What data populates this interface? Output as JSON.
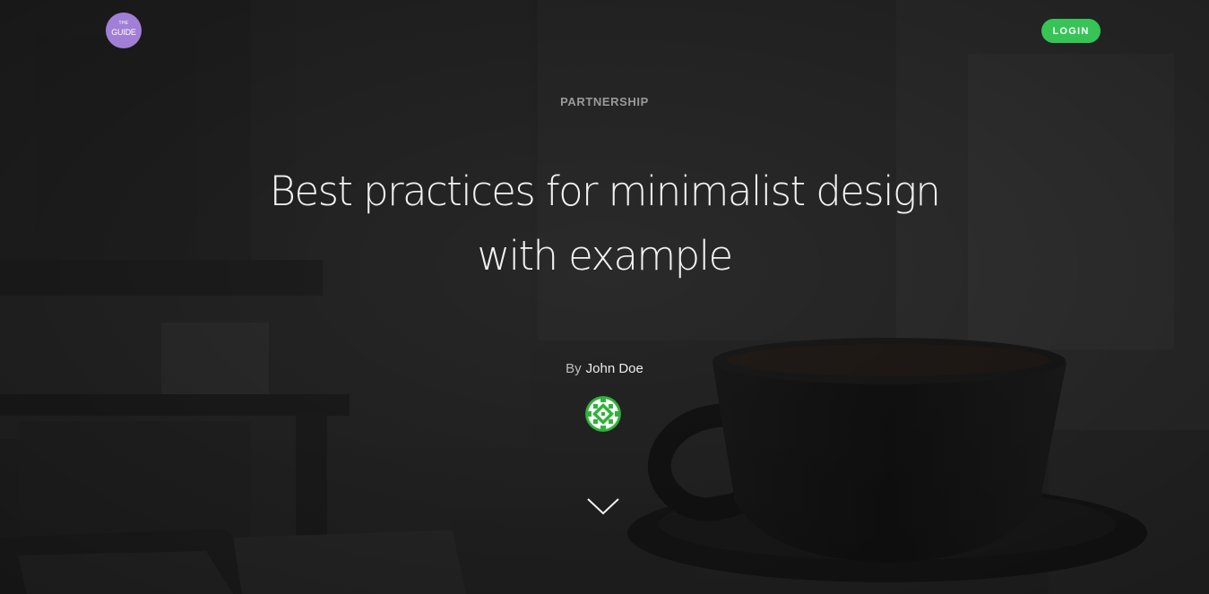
{
  "header": {
    "logo": {
      "small_text": "THE",
      "big_text": "GUIDE",
      "color": "#a27fd6"
    },
    "login_label": "LOGIN",
    "login_color": "#36c457"
  },
  "article": {
    "category": "PARTNERSHIP",
    "title": "Best practices for minimalist design with example",
    "byline_prefix": "By",
    "author": "John Doe",
    "author_avatar_icon": "green-pattern-avatar"
  },
  "icons": {
    "scroll": "chevron-down-icon"
  }
}
